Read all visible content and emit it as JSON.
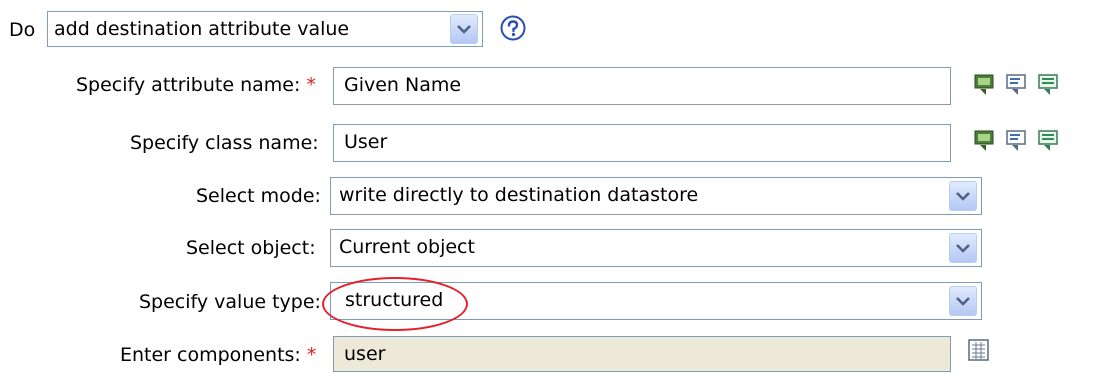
{
  "action": {
    "do_label": "Do",
    "value": "add destination attribute value",
    "help_icon": "question-mark-icon"
  },
  "rows": {
    "attr_name": {
      "label": "Specify attribute name:",
      "required": "*",
      "value": "Given Name"
    },
    "class_name": {
      "label": "Specify class name:",
      "value": "User"
    },
    "mode": {
      "label": "Select mode:",
      "value": "write directly to destination datastore"
    },
    "object": {
      "label": "Select object:",
      "value": "Current object"
    },
    "value_type": {
      "label": "Specify value type:",
      "value": "structured"
    },
    "components": {
      "label": "Enter components:",
      "required": "*",
      "value": "user"
    }
  },
  "icons": {
    "browse": "schema-browser-icon",
    "select": "select-attribute-icon",
    "edit": "edit-attribute-icon",
    "editor": "component-editor-icon"
  },
  "colors": {
    "field_border": "#7f9db9",
    "readonly_bg": "#ece9d8",
    "required": "#e02020",
    "highlight": "#e4202a"
  }
}
